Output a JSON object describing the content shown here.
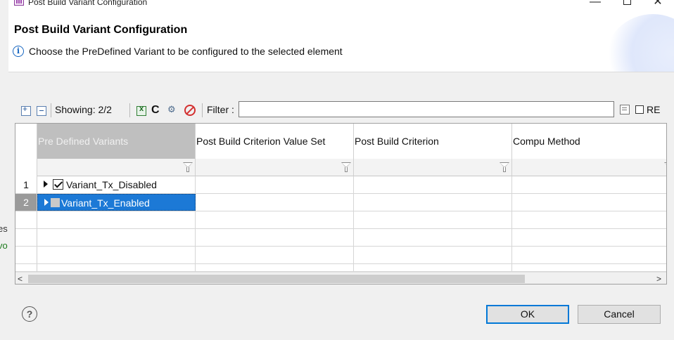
{
  "background": {
    "left_text_1": "es",
    "left_text_2": "vo"
  },
  "window": {
    "title": "Post Build Variant Configuration",
    "minimize_glyph": "—",
    "close_glyph": "✕"
  },
  "header": {
    "title": "Post Build Variant Configuration",
    "info_glyph": "i",
    "message": "Choose the PreDefined Variant to be configured to the selected element"
  },
  "toolbar": {
    "showing_label": "Showing: 2/2",
    "refresh_glyph": "C",
    "settings_glyph": "⚙",
    "filter_label": "Filter :",
    "filter_value": "",
    "regex_label": "RE",
    "regex_checked": false
  },
  "table": {
    "columns": [
      "Pre Defined Variants",
      "Post Build Criterion Value Set",
      "Post Build Criterion",
      "Compu Method"
    ],
    "rows": [
      {
        "num": "1",
        "label": "Variant_Tx_Disabled",
        "checked": true,
        "selected": false
      },
      {
        "num": "2",
        "label": "Variant_Tx_Enabled",
        "checked": false,
        "selected": true
      }
    ],
    "scroll_left_glyph": "<",
    "scroll_right_glyph": ">"
  },
  "footer": {
    "help_glyph": "?",
    "ok_label": "OK",
    "cancel_label": "Cancel"
  },
  "colors": {
    "selection": "#1c79d6",
    "header_selected": "#bfbfbf",
    "ok_border": "#0078d7",
    "info_blue": "#1565c0",
    "clear_filter_red": "#d32f2f"
  }
}
